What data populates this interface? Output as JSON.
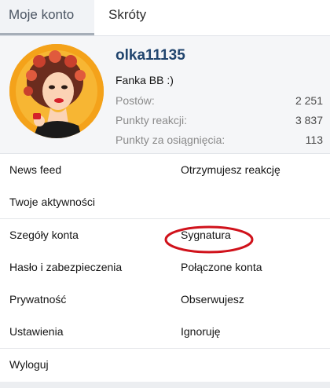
{
  "tabs": [
    {
      "label": "Moje konto"
    },
    {
      "label": "Skróty"
    }
  ],
  "profile": {
    "username": "olka11135",
    "user_title": "Fanka BB :)",
    "stats": [
      {
        "label": "Postów:",
        "value": "2 251"
      },
      {
        "label": "Punkty reakcji:",
        "value": "3 837"
      },
      {
        "label": "Punkty za osiągnięcia:",
        "value": "113"
      }
    ]
  },
  "links": {
    "news_feed": "News feed",
    "reactions_received": "Otrzymujesz reakcję",
    "your_activity": "Twoje aktywności",
    "account_details": "Szegóły konta",
    "signature": "Sygnatura",
    "password_security": "Hasło i zabezpieczenia",
    "connected_accounts": "Połączone konta",
    "privacy": "Prywatność",
    "following": "Obserwujesz",
    "preferences": "Ustawienia",
    "ignoring": "Ignoruję",
    "logout": "Wyloguj"
  },
  "colors": {
    "username": "#21456e",
    "annotation": "#d0121b",
    "avatar_background": "#f4a21a"
  }
}
